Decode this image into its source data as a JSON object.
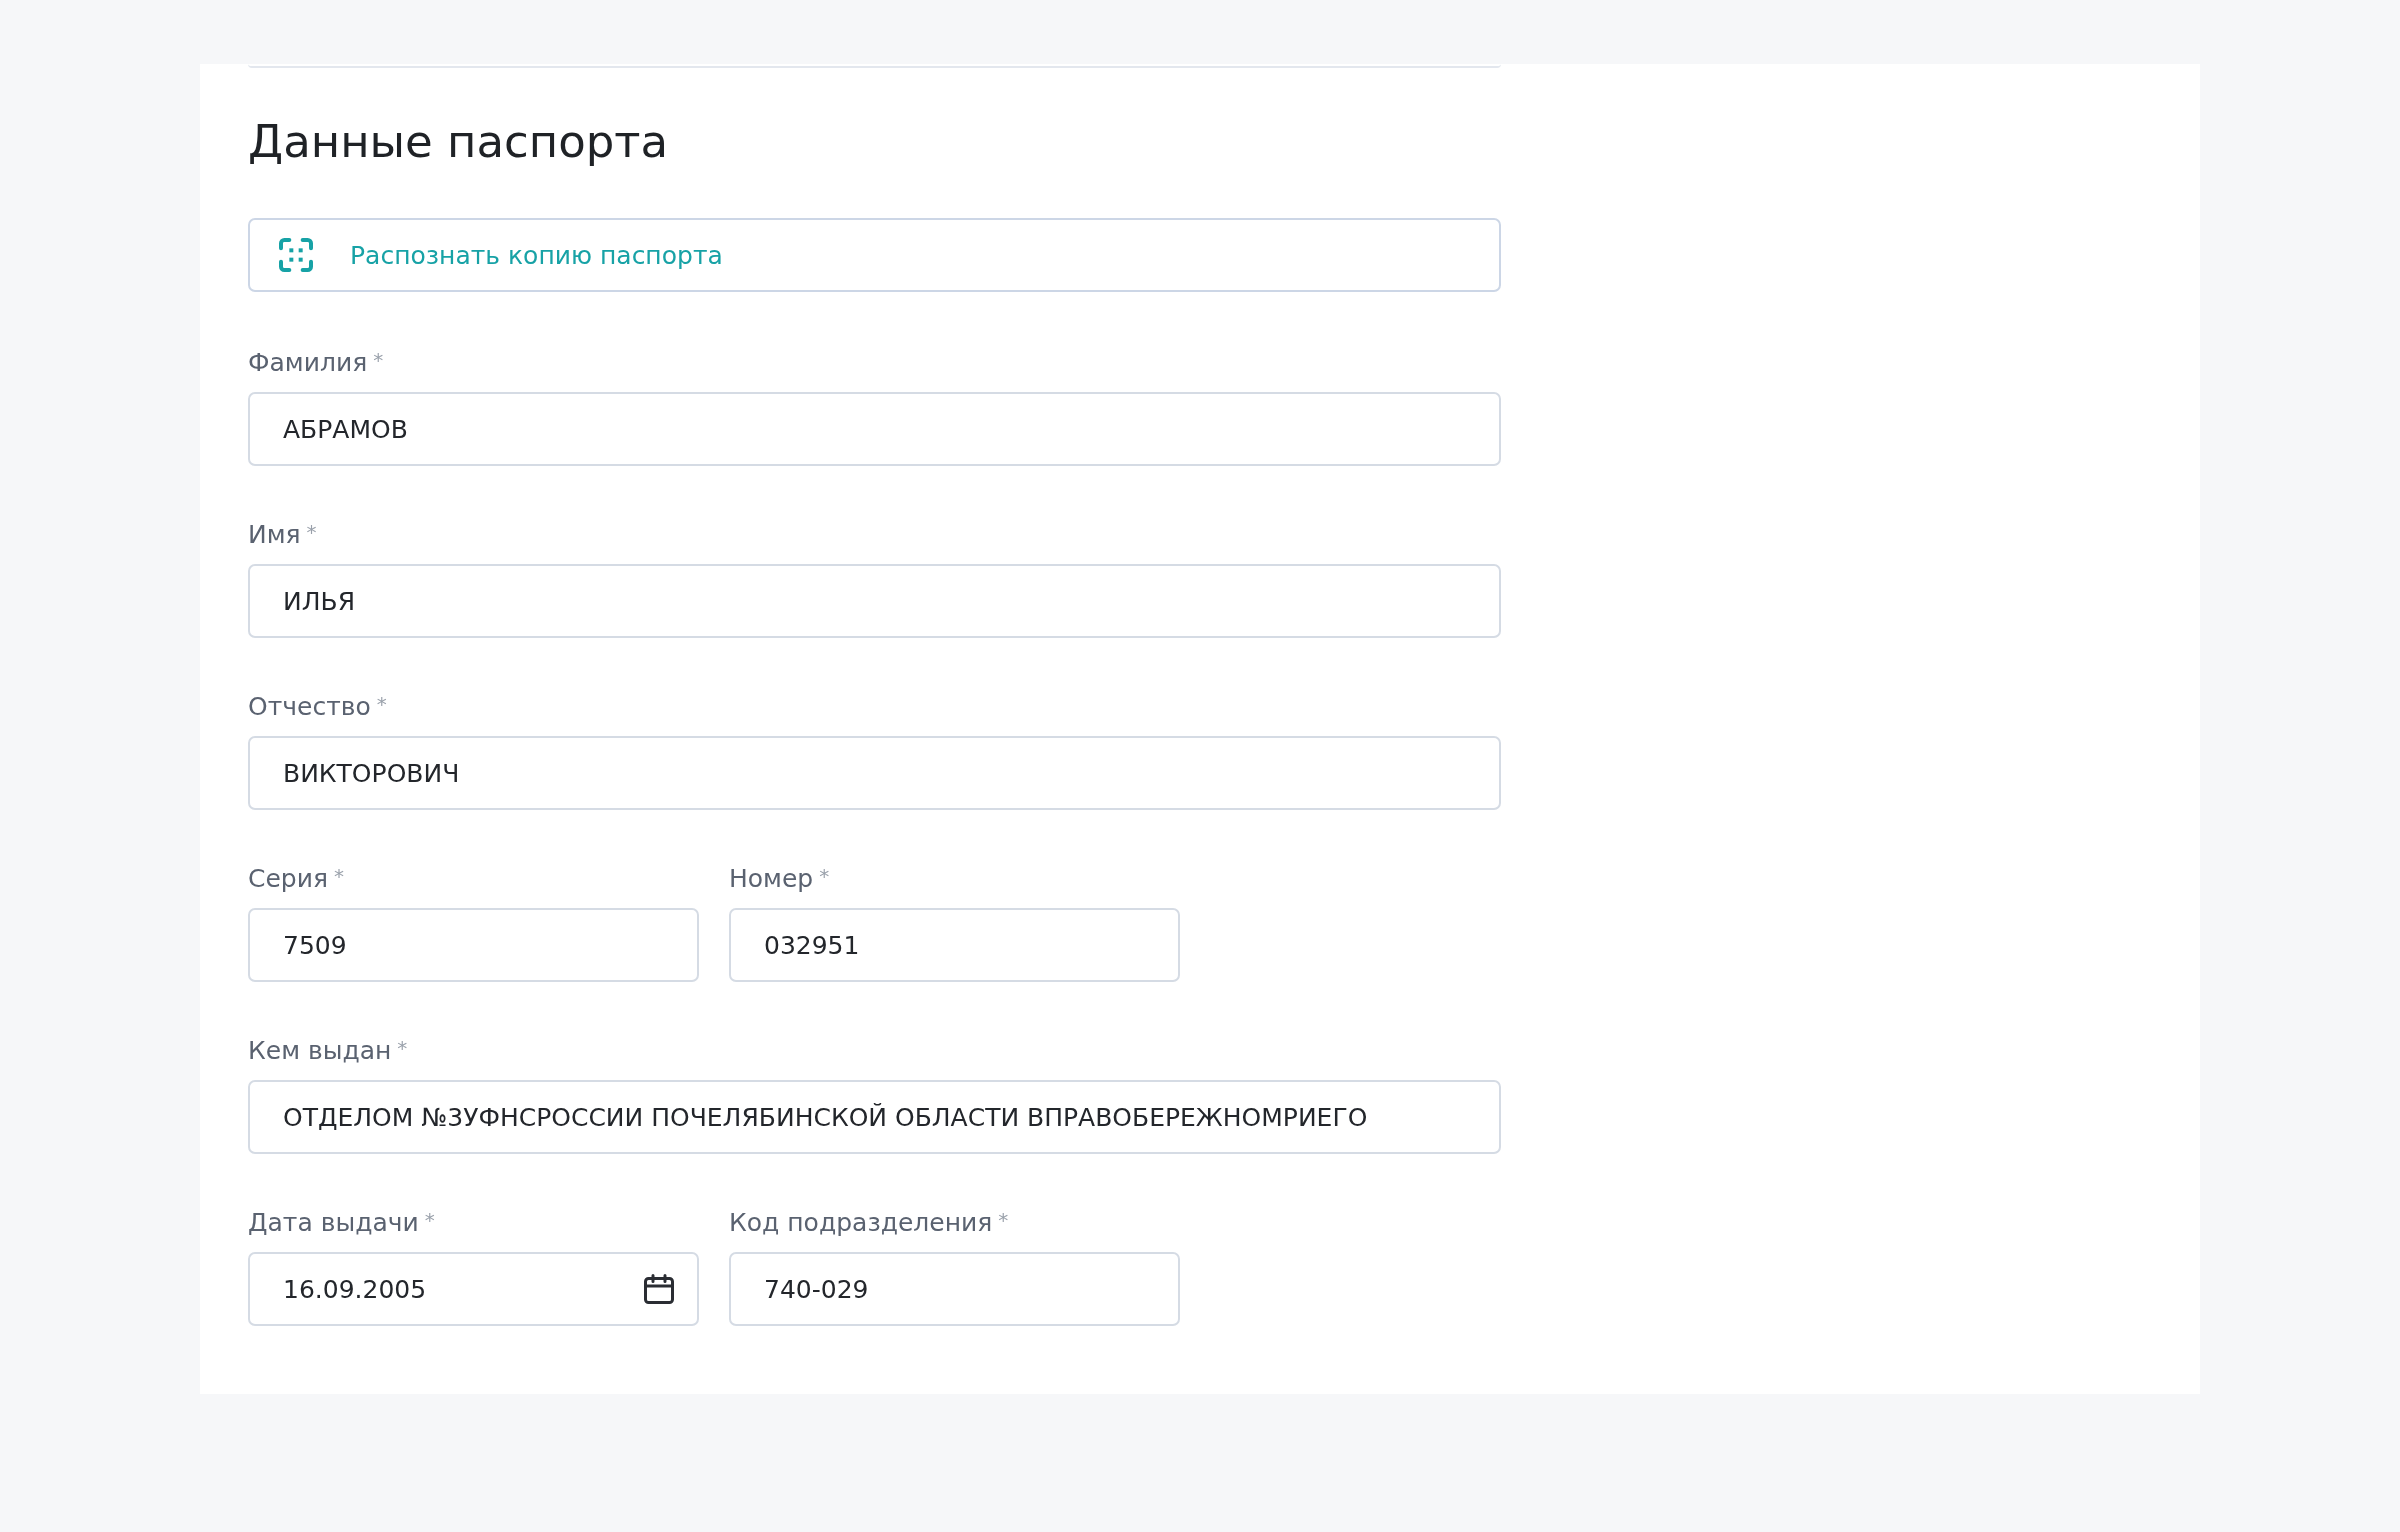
{
  "section_title": "Данные паспорта",
  "recognize_button": {
    "label": "Распознать копию паспорта"
  },
  "rows": [
    [
      {
        "label": "Фамилия",
        "required_mark": "*",
        "value": "АБРАМОВ",
        "kind": "text"
      }
    ],
    [
      {
        "label": "Имя",
        "required_mark": "*",
        "value": "ИЛЬЯ",
        "kind": "text"
      }
    ],
    [
      {
        "label": "Отчество",
        "required_mark": "*",
        "value": "ВИКТОРОВИЧ",
        "kind": "text"
      }
    ],
    [
      {
        "label": "Серия",
        "required_mark": "*",
        "value": "7509",
        "kind": "text"
      },
      {
        "label": "Номер",
        "required_mark": "*",
        "value": "032951",
        "kind": "text"
      }
    ],
    [
      {
        "label": "Кем выдан",
        "required_mark": "*",
        "value": "ОТДЕЛОМ №3УФНСРОССИИ ПОЧЕЛЯБИНСКОЙ ОБЛАСТИ ВПРАВОБЕРЕЖНОМРИЕГО",
        "kind": "text"
      }
    ],
    [
      {
        "label": "Дата выдачи",
        "required_mark": "*",
        "value": "16.09.2005",
        "kind": "date"
      },
      {
        "label": "Код подразделения",
        "required_mark": "*",
        "value": "740-029",
        "kind": "text"
      }
    ]
  ]
}
